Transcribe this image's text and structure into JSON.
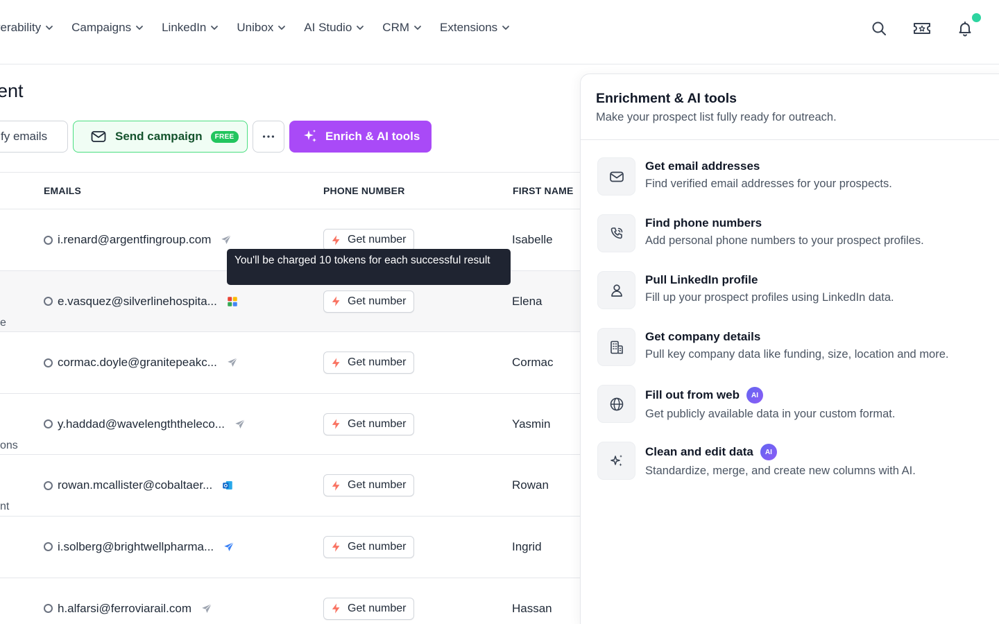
{
  "nav": {
    "items": [
      {
        "label": "verability"
      },
      {
        "label": "Campaigns"
      },
      {
        "label": "LinkedIn"
      },
      {
        "label": "Unibox"
      },
      {
        "label": "AI Studio"
      },
      {
        "label": "CRM"
      },
      {
        "label": "Extensions"
      }
    ],
    "icons": [
      "search-icon",
      "ticket-icon",
      "bell-icon"
    ],
    "notification_color": "#2dd4a0"
  },
  "page": {
    "title_fragment": "ent"
  },
  "toolbar": {
    "verify_label": "fy emails",
    "send_label": "Send campaign",
    "send_badge": "FREE",
    "enrich_label": "Enrich & AI tools",
    "enrich_color": "#a94af7"
  },
  "table": {
    "headers": {
      "emails": "EMAILS",
      "phone": "PHONE NUMBER",
      "first_name": "FIRST NAME"
    },
    "get_number_label": "Get number",
    "rows": [
      {
        "email": "i.renard@argentfingroup.com",
        "provider": "send-icon",
        "first_name": "Isabelle",
        "left_fragment": ""
      },
      {
        "email": "e.vasquez@silverlinehospita...",
        "provider": "google-icon",
        "first_name": "Elena",
        "left_fragment": "e"
      },
      {
        "email": "cormac.doyle@granitepeakc...",
        "provider": "send-icon",
        "first_name": "Cormac",
        "left_fragment": ""
      },
      {
        "email": "y.haddad@wavelengththeleco...",
        "provider": "send-icon",
        "first_name": "Yasmin",
        "left_fragment": "ons"
      },
      {
        "email": "rowan.mcallister@cobaltaer...",
        "provider": "outlook-icon",
        "first_name": "Rowan",
        "left_fragment": "nt"
      },
      {
        "email": "i.solberg@brightwellpharma...",
        "provider": "send-blue-icon",
        "first_name": "Ingrid",
        "left_fragment": ""
      },
      {
        "email": "h.alfarsi@ferroviarail.com",
        "provider": "send-icon",
        "first_name": "Hassan",
        "left_fragment": ""
      }
    ]
  },
  "tooltip": {
    "text": "You'll be charged 10 tokens for each successful result"
  },
  "panel": {
    "title": "Enrichment & AI tools",
    "subtitle": "Make your prospect list fully ready for outreach.",
    "tools": [
      {
        "title": "Get email addresses",
        "desc": "Find verified email addresses for your prospects.",
        "icon": "mail-icon",
        "ai": false
      },
      {
        "title": "Find phone numbers",
        "desc": "Add personal phone numbers to your prospect profiles.",
        "icon": "phone-icon",
        "ai": false
      },
      {
        "title": "Pull LinkedIn profile",
        "desc": "Fill up your prospect profiles using LinkedIn data.",
        "icon": "user-icon",
        "ai": false
      },
      {
        "title": "Get company details",
        "desc": "Pull key company data like funding, size, location and more.",
        "icon": "building-icon",
        "ai": false
      },
      {
        "title": "Fill out from web",
        "desc": "Get publicly available data in your custom format.",
        "icon": "globe-icon",
        "ai": true
      },
      {
        "title": "Clean and edit data",
        "desc": "Standardize, merge, and create new columns with AI.",
        "icon": "sparkles-icon",
        "ai": true
      }
    ],
    "ai_badge": "AI"
  }
}
